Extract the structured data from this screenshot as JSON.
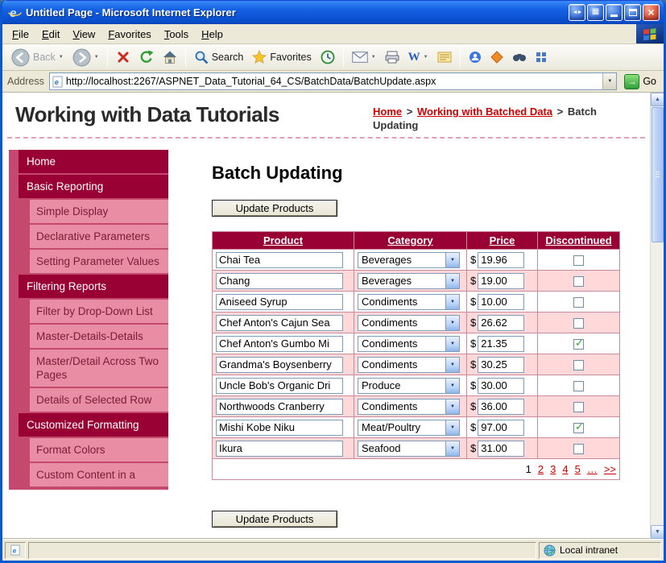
{
  "window": {
    "title": "Untitled Page - Microsoft Internet Explorer",
    "status_zone": "Local intranet"
  },
  "menubar": {
    "items": [
      "File",
      "Edit",
      "View",
      "Favorites",
      "Tools",
      "Help"
    ]
  },
  "toolbar": {
    "back_label": "Back",
    "search_label": "Search",
    "favorites_label": "Favorites",
    "edit_label": "W"
  },
  "addressbar": {
    "label": "Address",
    "url": "http://localhost:2267/ASPNET_Data_Tutorial_64_CS/BatchData/BatchUpdate.aspx",
    "go_label": "Go"
  },
  "header": {
    "site_title": "Working with Data Tutorials",
    "breadcrumb": {
      "home": "Home",
      "separator": ">",
      "section": "Working with Batched Data",
      "current": "Batch Updating"
    }
  },
  "sidebar": {
    "items": [
      {
        "label": "Home",
        "type": "header"
      },
      {
        "label": "Basic Reporting",
        "type": "header"
      },
      {
        "label": "Simple Display",
        "type": "sub"
      },
      {
        "label": "Declarative Parameters",
        "type": "sub"
      },
      {
        "label": "Setting Parameter Values",
        "type": "sub"
      },
      {
        "label": "Filtering Reports",
        "type": "header"
      },
      {
        "label": "Filter by Drop-Down List",
        "type": "sub"
      },
      {
        "label": "Master-Details-Details",
        "type": "sub"
      },
      {
        "label": "Master/Detail Across Two Pages",
        "type": "sub"
      },
      {
        "label": "Details of Selected Row",
        "type": "sub"
      },
      {
        "label": "Customized Formatting",
        "type": "header"
      },
      {
        "label": "Format Colors",
        "type": "sub"
      },
      {
        "label": "Custom Content in a",
        "type": "sub"
      }
    ]
  },
  "main": {
    "heading": "Batch Updating",
    "update_button_top": "Update Products",
    "update_button_bottom": "Update Products",
    "table": {
      "headers": [
        "Product",
        "Category",
        "Price",
        "Discontinued"
      ],
      "currency": "$",
      "rows": [
        {
          "product": "Chai Tea",
          "category": "Beverages",
          "price": "19.96",
          "discontinued": false
        },
        {
          "product": "Chang",
          "category": "Beverages",
          "price": "19.00",
          "discontinued": false
        },
        {
          "product": "Aniseed Syrup",
          "category": "Condiments",
          "price": "10.00",
          "discontinued": false
        },
        {
          "product": "Chef Anton's Cajun Sea",
          "category": "Condiments",
          "price": "26.62",
          "discontinued": false
        },
        {
          "product": "Chef Anton's Gumbo Mi",
          "category": "Condiments",
          "price": "21.35",
          "discontinued": true
        },
        {
          "product": "Grandma's Boysenberry",
          "category": "Condiments",
          "price": "30.25",
          "discontinued": false
        },
        {
          "product": "Uncle Bob's Organic Dri",
          "category": "Produce",
          "price": "30.00",
          "discontinued": false
        },
        {
          "product": "Northwoods Cranberry",
          "category": "Condiments",
          "price": "36.00",
          "discontinued": false
        },
        {
          "product": "Mishi Kobe Niku",
          "category": "Meat/Poultry",
          "price": "97.00",
          "discontinued": true
        },
        {
          "product": "Ikura",
          "category": "Seafood",
          "price": "31.00",
          "discontinued": false
        }
      ],
      "pager": {
        "current": "1",
        "links": [
          "2",
          "3",
          "4",
          "5",
          "…",
          ">>"
        ]
      }
    }
  },
  "icons": {
    "close": "×",
    "window_arrows": "◄►",
    "window_grid": "▦",
    "dropdown": "▼",
    "scroll_up": "▲",
    "scroll_down": "▼",
    "go_arrow": "→",
    "check": "✓"
  },
  "colors": {
    "accent_maroon": "#990033",
    "sidebar_strip": "#c5486f",
    "sidebar_sub_bg": "#e88da4",
    "row_alt_pink": "#ffd9da",
    "link_red": "#cc0000",
    "titlebar_blue": "#0d55d6"
  }
}
